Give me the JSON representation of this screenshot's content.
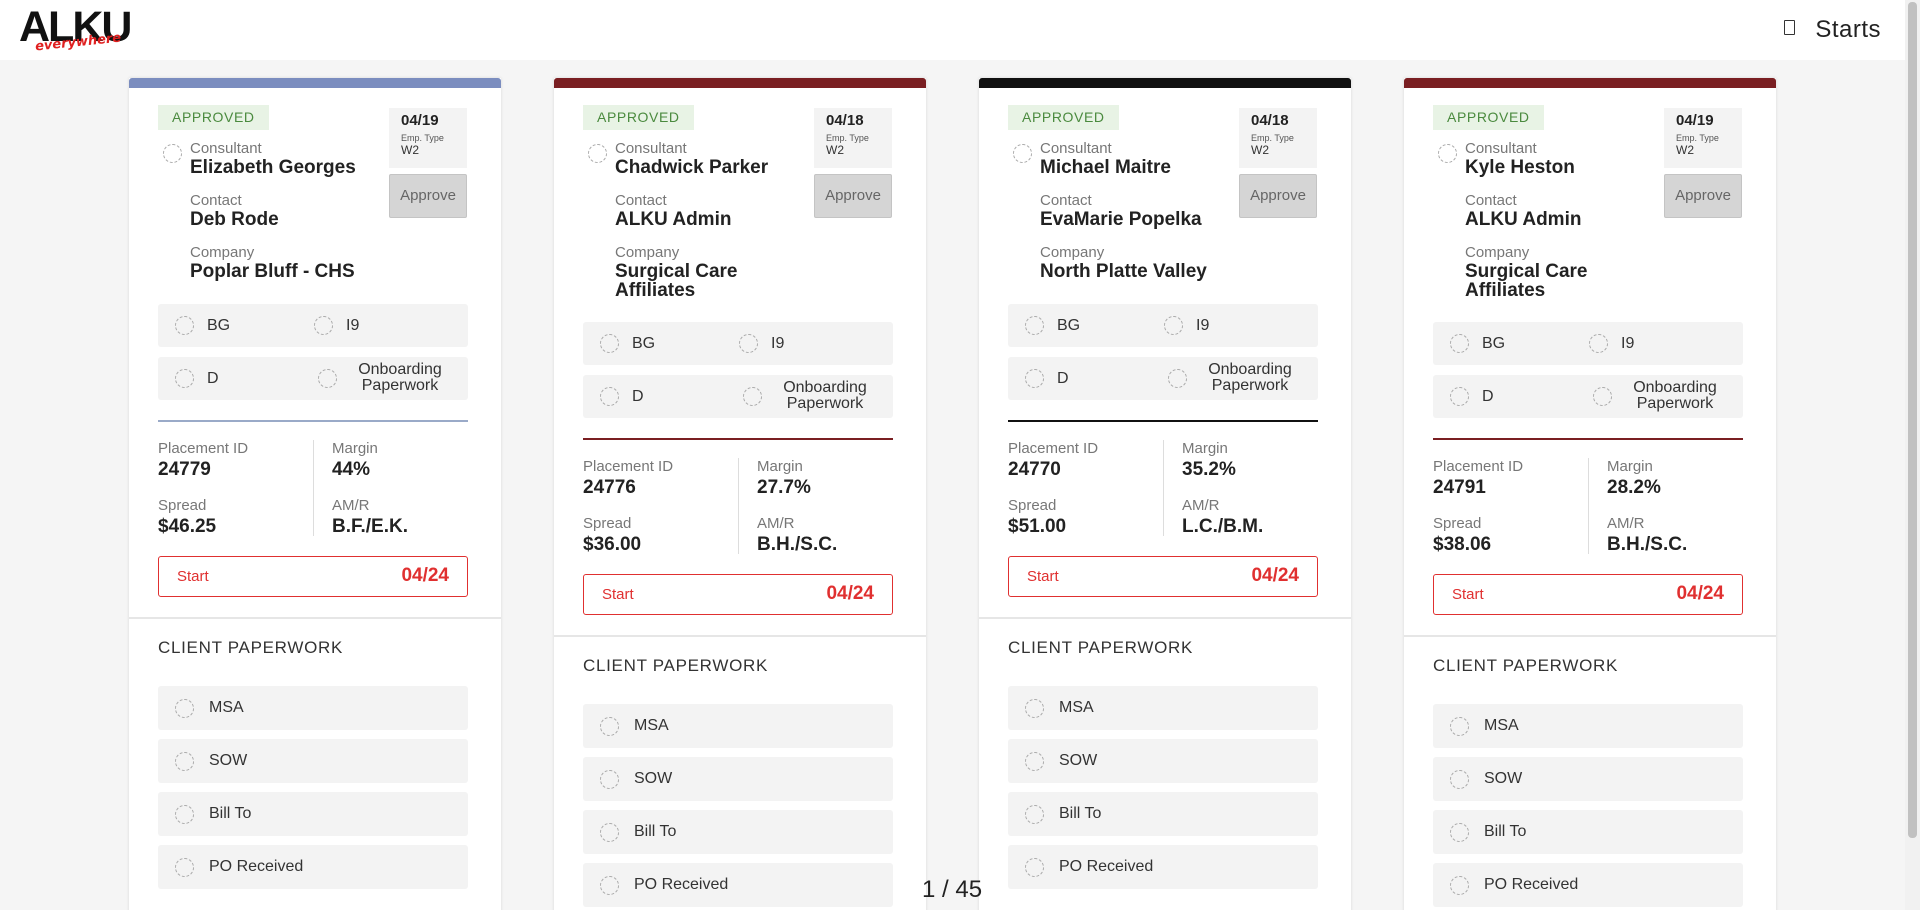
{
  "header": {
    "logo_main": "ALKU",
    "logo_sub": "everywhere",
    "page_label": "Starts"
  },
  "colors": {
    "approved_bg": "#e8f3e5",
    "approved_text": "#4a8a3e",
    "start_red": "#e03030"
  },
  "cards": [
    {
      "accent": "#7b8dbf",
      "status": "APPROVED",
      "date": "04/19",
      "emp_type_label": "Emp. Type",
      "emp_type": "W2",
      "approve_label": "Approve",
      "consultant_label": "Consultant",
      "consultant": "Elizabeth Georges",
      "contact_label": "Contact",
      "contact": "Deb Rode",
      "company_label": "Company",
      "company": "Poplar Bluff - CHS",
      "checks": [
        "BG",
        "I9",
        "D",
        "Onboarding Paperwork"
      ],
      "placement_label": "Placement ID",
      "placement_id": "24779",
      "margin_label": "Margin",
      "margin": "44%",
      "spread_label": "Spread",
      "spread": "$46.25",
      "amr_label": "AM/R",
      "amr": "B.F./E.K.",
      "start_label": "Start",
      "start_date": "04/24",
      "client_paperwork_title": "CLIENT PAPERWORK",
      "client_paperwork": [
        "MSA",
        "SOW",
        "Bill To",
        "PO Received"
      ]
    },
    {
      "accent": "#7a1f22",
      "status": "APPROVED",
      "date": "04/18",
      "emp_type_label": "Emp. Type",
      "emp_type": "W2",
      "approve_label": "Approve",
      "consultant_label": "Consultant",
      "consultant": "Chadwick Parker",
      "contact_label": "Contact",
      "contact": "ALKU Admin",
      "company_label": "Company",
      "company": "Surgical Care Affiliates",
      "checks": [
        "BG",
        "I9",
        "D",
        "Onboarding Paperwork"
      ],
      "placement_label": "Placement ID",
      "placement_id": "24776",
      "margin_label": "Margin",
      "margin": "27.7%",
      "spread_label": "Spread",
      "spread": "$36.00",
      "amr_label": "AM/R",
      "amr": "B.H./S.C.",
      "start_label": "Start",
      "start_date": "04/24",
      "client_paperwork_title": "CLIENT PAPERWORK",
      "client_paperwork": [
        "MSA",
        "SOW",
        "Bill To",
        "PO Received"
      ]
    },
    {
      "accent": "#111111",
      "status": "APPROVED",
      "date": "04/18",
      "emp_type_label": "Emp. Type",
      "emp_type": "W2",
      "approve_label": "Approve",
      "consultant_label": "Consultant",
      "consultant": "Michael Maitre",
      "contact_label": "Contact",
      "contact": "EvaMarie Popelka",
      "company_label": "Company",
      "company": "North Platte Valley",
      "checks": [
        "BG",
        "I9",
        "D",
        "Onboarding Paperwork"
      ],
      "placement_label": "Placement ID",
      "placement_id": "24770",
      "margin_label": "Margin",
      "margin": "35.2%",
      "spread_label": "Spread",
      "spread": "$51.00",
      "amr_label": "AM/R",
      "amr": "L.C./B.M.",
      "start_label": "Start",
      "start_date": "04/24",
      "client_paperwork_title": "CLIENT PAPERWORK",
      "client_paperwork": [
        "MSA",
        "SOW",
        "Bill To",
        "PO Received"
      ]
    },
    {
      "accent": "#7a1f22",
      "status": "APPROVED",
      "date": "04/19",
      "emp_type_label": "Emp. Type",
      "emp_type": "W2",
      "approve_label": "Approve",
      "consultant_label": "Consultant",
      "consultant": "Kyle Heston",
      "contact_label": "Contact",
      "contact": "ALKU Admin",
      "company_label": "Company",
      "company": "Surgical Care Affiliates",
      "checks": [
        "BG",
        "I9",
        "D",
        "Onboarding Paperwork"
      ],
      "placement_label": "Placement ID",
      "placement_id": "24791",
      "margin_label": "Margin",
      "margin": "28.2%",
      "spread_label": "Spread",
      "spread": "$38.06",
      "amr_label": "AM/R",
      "amr": "B.H./S.C.",
      "start_label": "Start",
      "start_date": "04/24",
      "client_paperwork_title": "CLIENT PAPERWORK",
      "client_paperwork": [
        "MSA",
        "SOW",
        "Bill To",
        "PO Received"
      ]
    }
  ],
  "pager": "1 / 45"
}
